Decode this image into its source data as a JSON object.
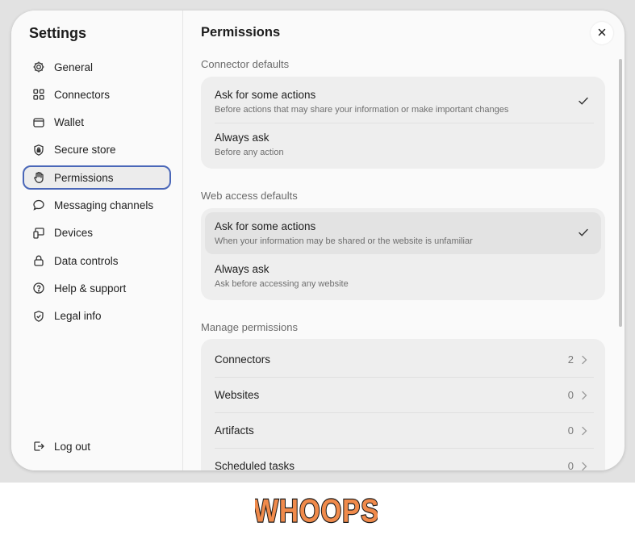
{
  "sidebar": {
    "title": "Settings",
    "items": [
      {
        "label": "General",
        "icon": "gear-icon"
      },
      {
        "label": "Connectors",
        "icon": "grid-icon"
      },
      {
        "label": "Wallet",
        "icon": "wallet-icon"
      },
      {
        "label": "Secure store",
        "icon": "shield-lock-icon"
      },
      {
        "label": "Permissions",
        "icon": "hand-icon",
        "active": true
      },
      {
        "label": "Messaging channels",
        "icon": "chat-bubble-icon"
      },
      {
        "label": "Devices",
        "icon": "devices-icon"
      },
      {
        "label": "Data controls",
        "icon": "lock-icon"
      },
      {
        "label": "Help & support",
        "icon": "help-circle-icon"
      },
      {
        "label": "Legal info",
        "icon": "shield-check-icon"
      }
    ],
    "logout": {
      "label": "Log out",
      "icon": "logout-icon"
    }
  },
  "main": {
    "title": "Permissions",
    "close_icon": "close-icon",
    "connector_defaults": {
      "label": "Connector defaults",
      "options": [
        {
          "title": "Ask for some actions",
          "desc": "Before actions that may share your information or make important changes",
          "selected": true
        },
        {
          "title": "Always ask",
          "desc": "Before any action",
          "selected": false
        }
      ]
    },
    "web_access_defaults": {
      "label": "Web access defaults",
      "options": [
        {
          "title": "Ask for some actions",
          "desc": "When your information may be shared or the website is unfamiliar",
          "selected": true
        },
        {
          "title": "Always ask",
          "desc": "Ask before accessing any website",
          "selected": false
        }
      ]
    },
    "manage_permissions": {
      "label": "Manage permissions",
      "rows": [
        {
          "label": "Connectors",
          "count": "2"
        },
        {
          "label": "Websites",
          "count": "0"
        },
        {
          "label": "Artifacts",
          "count": "0"
        },
        {
          "label": "Scheduled tasks",
          "count": "0"
        }
      ]
    }
  },
  "footer": {
    "logo_text": "WHOOPS"
  },
  "colors": {
    "accent_outline": "#4a67b8",
    "logo_fill": "#f08a4b",
    "logo_stroke": "#1a1a1a"
  }
}
